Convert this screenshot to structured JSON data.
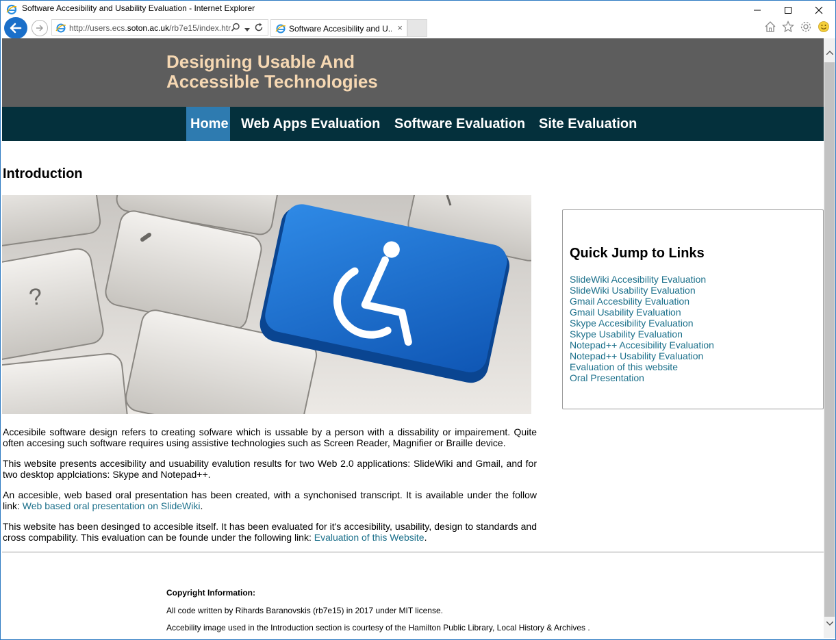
{
  "window": {
    "title": "Software Accesibility and Usability Evaluation - Internet Explorer"
  },
  "browser": {
    "url_prefix": "http://users.ecs.",
    "url_domain": "soton.ac.uk",
    "url_suffix": "/rb7e15/index.htr",
    "tab_label": "Software Accesibility and U...",
    "tab_close": "×"
  },
  "site": {
    "title_line1": "Designing Usable And",
    "title_line2": "Accessible Technologies",
    "nav": [
      {
        "label": "Home",
        "active": true
      },
      {
        "label": "Web Apps Evaluation",
        "active": false
      },
      {
        "label": "Software Evaluation",
        "active": false
      },
      {
        "label": "Site Evaluation",
        "active": false
      }
    ]
  },
  "main": {
    "heading": "Introduction",
    "hero_icon": "wheelchair-key-icon",
    "hero_key_symbol": "?",
    "paragraphs": {
      "p1": "Accesibile software design refers to creating sofware which is ussable by a person with a dissability or impairement. Quite often accesing such software requires using assistive technologies such as Screen Reader, Magnifier or Braille device.",
      "p2": "This website presents accesibility and usuability evalution results for two Web 2.0 applications: SlideWiki and Gmail, and for two desktop applciations: Skype and Notepad++.",
      "p3_text": "An accesible, web based oral presentation has been created, with a synchonised transcript. It is available under the follow link: ",
      "p3_link": "Web based oral presentation on SlideWiki",
      "p3_end": ".",
      "p4_text": "This website has been desinged to accesible itself. It has been evaluated for it's accesibility, usability, design to standards and cross compability. This evaluation can be founde under the following link: ",
      "p4_link": "Evaluation of this Website",
      "p4_end": "."
    }
  },
  "quick_links": {
    "heading": "Quick Jump to Links",
    "items": [
      "SlideWiki Accesibility Evaluation",
      "SlideWiki Usability Evaluation",
      "Gmail Accesbility Evaluation",
      "Gmail Usability Evaluation",
      "Skype Accesibility Evaluation",
      "Skype Usability Evaluation",
      "Notepad++ Accesibility Evaluation",
      "Notepad++ Usability Evaluation",
      "Evaluation of this website",
      "Oral Presentation"
    ]
  },
  "footer": {
    "copyright_heading": "Copyright Information:",
    "line1": "All code written by Rihards Baranovskis (rb7e15) in 2017 under MIT license.",
    "line2": "Accebility image used in the Introduction section is courtesy of the Hamilton Public Library, Local History & Archives ."
  },
  "colors": {
    "header_bg": "#5d5d5d",
    "title_color": "#f6d8b3",
    "nav_bg": "#04303c",
    "nav_active": "#2e7bb0",
    "link": "#1a6f8a",
    "key_blue": "#1a6fd0"
  }
}
